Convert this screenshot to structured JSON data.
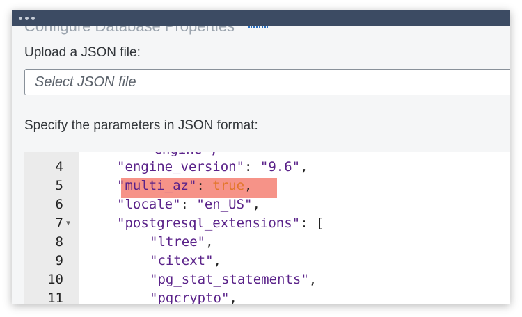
{
  "window": {
    "ghost_heading": "Configure Database Properties"
  },
  "upload": {
    "label": "Upload a JSON file:",
    "placeholder": "Select JSON file"
  },
  "params": {
    "label": "Specify the parameters in JSON format:"
  },
  "editor": {
    "partial_line": "\"engine\",",
    "lines": [
      {
        "num": "4",
        "key": "\"engine_version\"",
        "sep": ": ",
        "value": "\"9.6\"",
        "end": ","
      },
      {
        "num": "5",
        "key": "\"multi_az\"",
        "sep": ": ",
        "value": "true",
        "end": ","
      },
      {
        "num": "6",
        "key": "\"locale\"",
        "sep": ": ",
        "value": "\"en_US\"",
        "end": ","
      },
      {
        "num": "7",
        "key": "\"postgresql_extensions\"",
        "sep": ": ",
        "value": "[",
        "end": ""
      },
      {
        "num": "8",
        "value": "\"ltree\"",
        "end": ","
      },
      {
        "num": "9",
        "value": "\"citext\"",
        "end": ","
      },
      {
        "num": "10",
        "value": "\"pg_stat_statements\"",
        "end": ","
      },
      {
        "num": "11",
        "value": "\"pgcrypto\"",
        "end": ","
      }
    ]
  },
  "colors": {
    "titlebar": "#3c4b63",
    "string": "#5a2289",
    "boolean": "#e2762a",
    "highlight": "#f2695a"
  }
}
